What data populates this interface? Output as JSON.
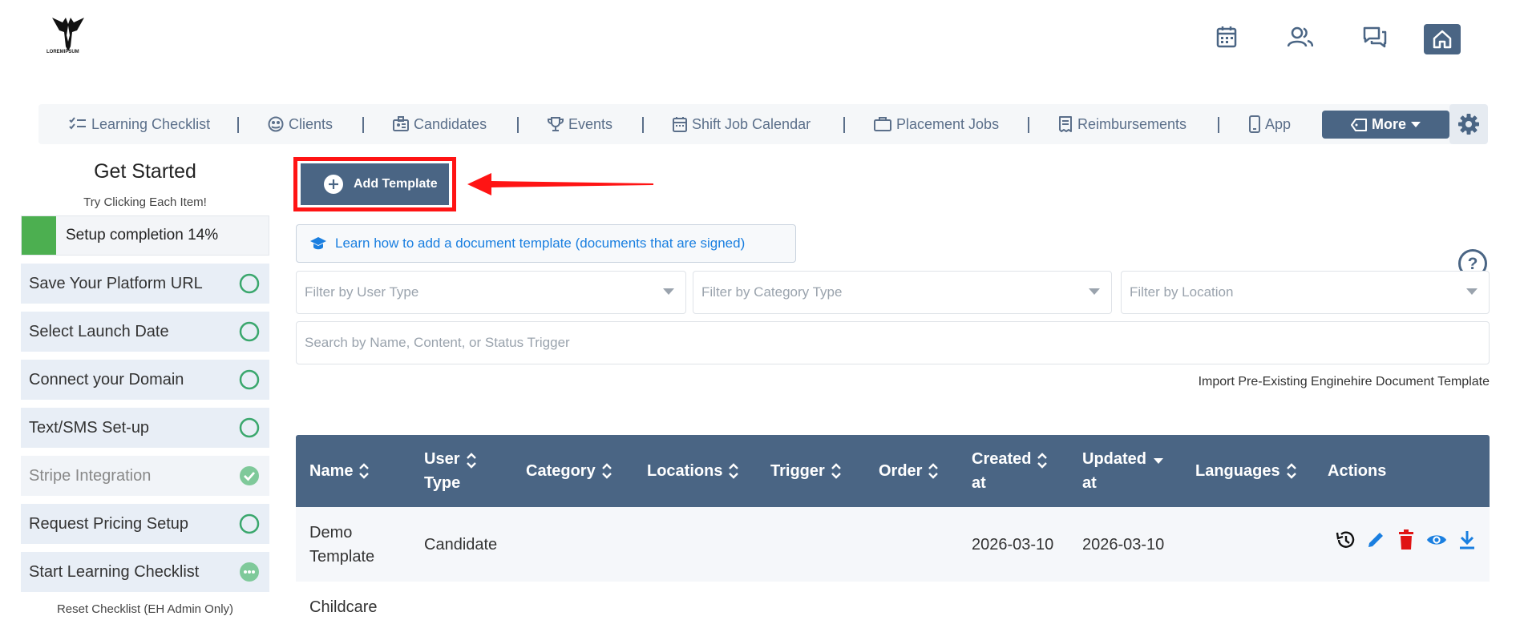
{
  "header": {
    "logo_text": "LOREMIPSUM",
    "icons": [
      "calendar-icon",
      "users-icon",
      "chat-icon",
      "home-icon"
    ]
  },
  "nav": {
    "items": [
      {
        "label": "Learning Checklist",
        "icon": "checklist-icon"
      },
      {
        "label": "Clients",
        "icon": "clients-icon"
      },
      {
        "label": "Candidates",
        "icon": "candidates-icon"
      },
      {
        "label": "Events",
        "icon": "trophy-icon"
      },
      {
        "label": "Shift Job Calendar",
        "icon": "calendar-icon"
      },
      {
        "label": "Placement Jobs",
        "icon": "briefcase-icon"
      },
      {
        "label": "Reimbursements",
        "icon": "receipt-icon"
      },
      {
        "label": "App",
        "icon": "phone-icon"
      }
    ],
    "more_label": "More"
  },
  "sidebar": {
    "title": "Get Started",
    "subtitle": "Try Clicking Each Item!",
    "progress_label": "Setup completion 14%",
    "progress_value": 0.14,
    "tasks": [
      {
        "label": "Save Your Platform URL",
        "status": "pending"
      },
      {
        "label": "Select Launch Date",
        "status": "pending"
      },
      {
        "label": "Connect your Domain",
        "status": "pending"
      },
      {
        "label": "Text/SMS Set-up",
        "status": "pending"
      },
      {
        "label": "Stripe Integration",
        "status": "done"
      },
      {
        "label": "Request Pricing Setup",
        "status": "pending"
      },
      {
        "label": "Start Learning Checklist",
        "status": "in-progress"
      }
    ],
    "reset_label": "Reset Checklist (EH Admin Only)"
  },
  "main": {
    "add_template_label": "Add Template",
    "learn_link": "Learn how to add a document template (documents that are signed)",
    "filters": {
      "user_type_placeholder": "Filter by User Type",
      "category_placeholder": "Filter by Category Type",
      "location_placeholder": "Filter by Location"
    },
    "search_placeholder": "Search by Name, Content, or Status Trigger",
    "import_link": "Import Pre-Existing Enginehire Document Template"
  },
  "table": {
    "columns": [
      "Name",
      "User Type",
      "Category",
      "Locations",
      "Trigger",
      "Order",
      "Created at",
      "Updated at",
      "Languages",
      "Actions"
    ],
    "column_lines": {
      "user_type": [
        "User",
        "Type"
      ],
      "created": [
        "Created",
        "at"
      ],
      "updated": [
        "Updated",
        "at"
      ]
    },
    "rows": [
      {
        "name_lines": [
          "Demo",
          "Template"
        ],
        "user_type": "Candidate",
        "category": "",
        "locations": "",
        "trigger": "",
        "order": "",
        "created": "2026-03-10",
        "updated": "2026-03-10",
        "languages": ""
      },
      {
        "name_lines": [
          "Childcare"
        ]
      }
    ]
  },
  "colors": {
    "primary": "#4a6584",
    "highlight": "#ff1414",
    "link": "#1a7fe0",
    "success": "#4caf50"
  }
}
